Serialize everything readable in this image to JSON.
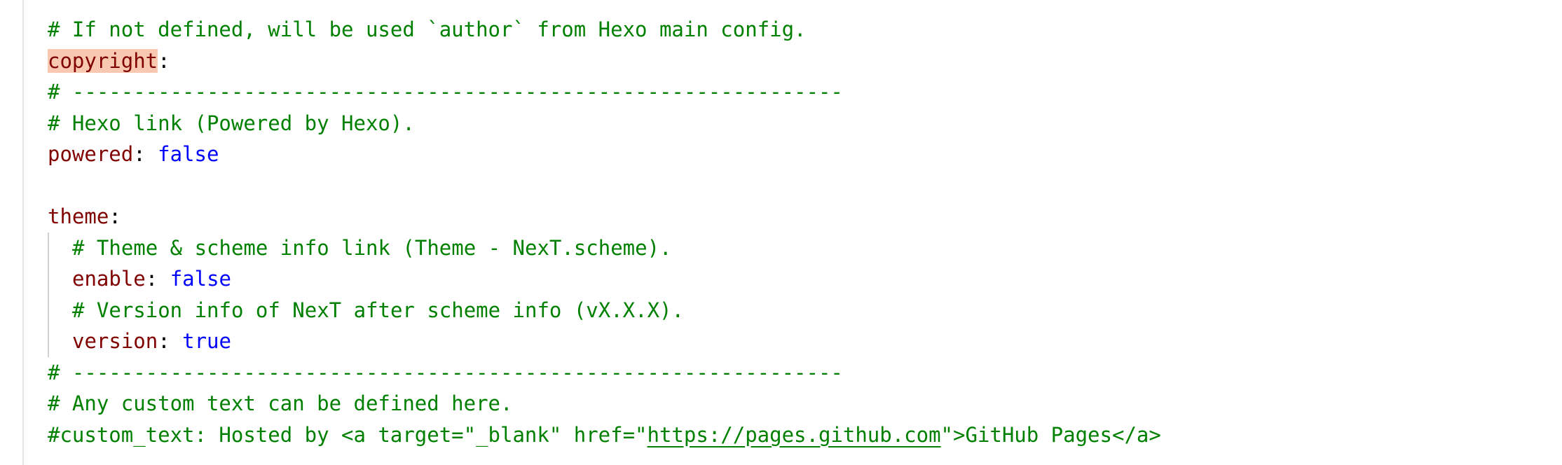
{
  "editor": {
    "lines": {
      "l1": {
        "comment": "# If not defined, will be used `author` from Hexo main config."
      },
      "l2": {
        "key": "copyright",
        "colon": ":"
      },
      "l3": {
        "comment": "# ---------------------------------------------------------------"
      },
      "l4": {
        "comment": "# Hexo link (Powered by Hexo)."
      },
      "l5": {
        "key": "powered",
        "colon": ": ",
        "value": "false"
      },
      "l6": {
        "text": ""
      },
      "l7": {
        "key": "theme",
        "colon": ":"
      },
      "l8": {
        "comment": "# Theme & scheme info link (Theme - NexT.scheme)."
      },
      "l9": {
        "key": "enable",
        "colon": ": ",
        "value": "false"
      },
      "l10": {
        "comment": "# Version info of NexT after scheme info (vX.X.X)."
      },
      "l11": {
        "key": "version",
        "colon": ": ",
        "value": "true"
      },
      "l12": {
        "comment": "# ---------------------------------------------------------------"
      },
      "l13": {
        "comment": "# Any custom text can be defined here."
      },
      "l14": {
        "comment_before": "#custom_text: Hosted by <a target=\"_blank\" href=\"",
        "link": "https://pages.github.com",
        "comment_after": "\">GitHub Pages</a>"
      }
    }
  },
  "colors": {
    "comment": "#008000",
    "key": "#800000",
    "boolean": "#0000ff",
    "highlight": "#f8c9b0"
  }
}
